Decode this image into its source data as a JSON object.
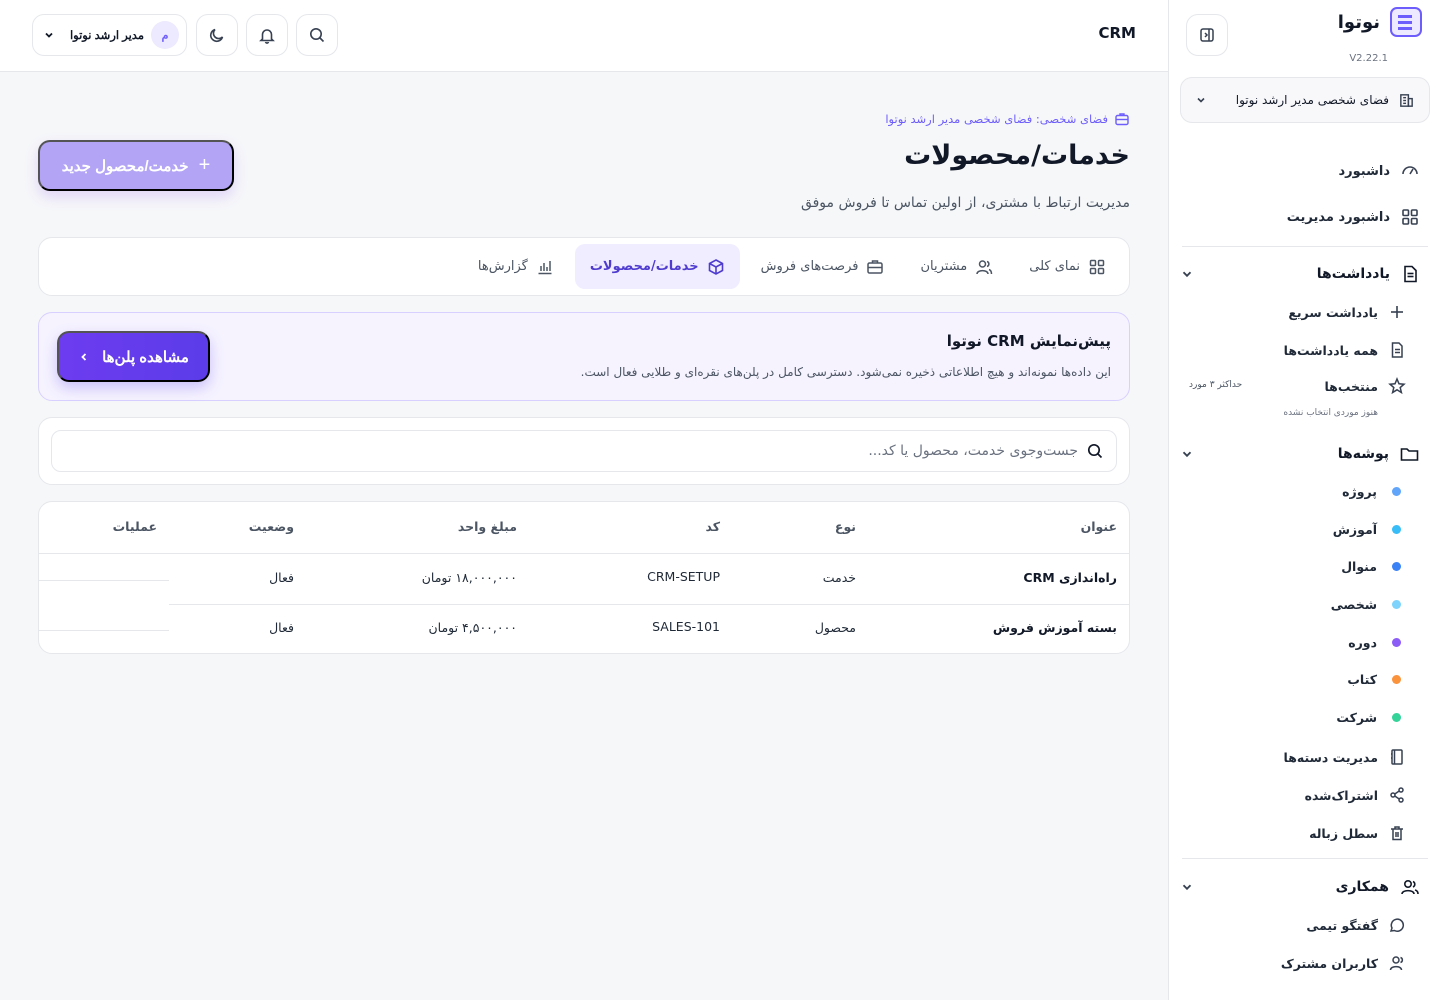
{
  "app": {
    "name": "نوتوا",
    "version": "V2.22.1",
    "module_title": "CRM"
  },
  "workspace": {
    "label": "فضای شخصی مدیر ارشد نوتوا"
  },
  "sidebar": {
    "main_items": [
      {
        "label": "داشبورد",
        "icon": "gauge-icon"
      },
      {
        "label": "داشبورد مدیریت",
        "icon": "grid-icon"
      }
    ],
    "notes": {
      "title": "یادداشت‌ها",
      "items": [
        {
          "label": "یادداشت سریع",
          "icon": "plus-icon"
        },
        {
          "label": "همه یادداشت‌ها",
          "icon": "document-icon"
        },
        {
          "label": "منتخب‌ها",
          "icon": "star-icon"
        }
      ],
      "favorites_max": "حداکثر ۳ مورد",
      "favorites_empty": "هنوز موردی انتخاب نشده"
    },
    "folders": {
      "title": "پوشه‌ها",
      "items": [
        {
          "label": "پروژه",
          "color": "#60a5fa"
        },
        {
          "label": "آموزش",
          "color": "#38bdf8"
        },
        {
          "label": "منوال",
          "color": "#3b82f6"
        },
        {
          "label": "شخصی",
          "color": "#7dd3fc"
        },
        {
          "label": "دوره",
          "color": "#8b5cf6"
        },
        {
          "label": "کتاب",
          "color": "#fb923c"
        },
        {
          "label": "شرکت",
          "color": "#34d399"
        }
      ],
      "extra_items": [
        {
          "label": "مدیریت دسته‌ها",
          "icon": "book-icon"
        },
        {
          "label": "اشتراک‌شده",
          "icon": "share-icon"
        },
        {
          "label": "سطل زباله",
          "icon": "trash-icon"
        }
      ]
    },
    "collaboration": {
      "title": "همکاری",
      "items": [
        {
          "label": "گفتگو تیمی",
          "icon": "chat-icon"
        },
        {
          "label": "کاربران مشترک",
          "icon": "user-icon"
        }
      ]
    }
  },
  "topbar": {
    "user_name": "مدیر ارشد نوتوا",
    "avatar_letter": "م"
  },
  "main": {
    "workspace_crumb": "فضای شخصی: فضای شخصی مدیر ارشد نوتوا",
    "title": "خدمات/محصولات",
    "subtitle": "مدیریت ارتباط با مشتری، از اولین تماس تا فروش موفق",
    "new_button": "خدمت/محصول جدید",
    "tabs": [
      {
        "label": "نمای کلی",
        "icon": "grid-icon",
        "active": false
      },
      {
        "label": "مشتریان",
        "icon": "users-icon",
        "active": false
      },
      {
        "label": "فرصت‌های فروش",
        "icon": "briefcase-icon",
        "active": false
      },
      {
        "label": "خدمات/محصولات",
        "icon": "box-icon",
        "active": true
      },
      {
        "label": "گزارش‌ها",
        "icon": "bar-chart-icon",
        "active": false
      }
    ],
    "promo": {
      "title": "پیش‌نمایش CRM نوتوا",
      "description": "این داده‌ها نمونه‌اند و هیچ اطلاعاتی ذخیره نمی‌شود. دسترسی کامل در پلن‌های نقره‌ای و طلایی فعال است.",
      "button": "مشاهده پلن‌ها"
    },
    "search": {
      "placeholder": "جست‌وجوی خدمت، محصول یا کد..."
    },
    "table": {
      "columns": [
        "عنوان",
        "نوع",
        "کد",
        "مبلغ واحد",
        "وضعیت",
        "عملیات"
      ],
      "rows": [
        {
          "title": "راه‌اندازی CRM",
          "type": "خدمت",
          "code": "CRM-SETUP",
          "price": "۱۸,۰۰۰,۰۰۰ تومان",
          "status": "فعال"
        },
        {
          "title": "بسته آموزش فروش",
          "type": "محصول",
          "code": "SALES-101",
          "price": "۴,۵۰۰,۰۰۰ تومان",
          "status": "فعال"
        }
      ]
    }
  }
}
